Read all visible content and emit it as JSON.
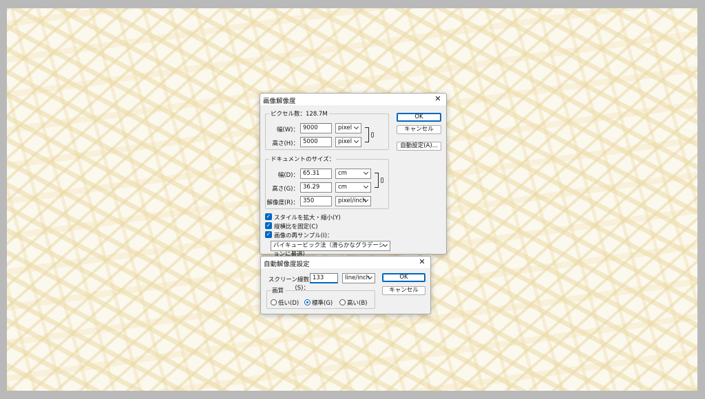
{
  "image_size": {
    "title": "画像解像度",
    "pixel_dimensions_label": "ピクセル数：128.7M",
    "width_label": "幅(W)：",
    "width_value": "9000",
    "width_unit": "pixel",
    "height_label": "高さ(H)：",
    "height_value": "5000",
    "height_unit": "pixel",
    "document_size_label": "ドキュメントのサイズ：",
    "doc_width_label": "幅(D)：",
    "doc_width_value": "65.31",
    "doc_width_unit": "cm",
    "doc_height_label": "高さ(G)：",
    "doc_height_value": "36.29",
    "doc_height_unit": "cm",
    "resolution_label": "解像度(R)：",
    "resolution_value": "350",
    "resolution_unit": "pixel/inch",
    "scale_styles_label": "スタイルを拡大・縮小(Y)",
    "constrain_label": "縦横比を固定(C)",
    "resample_label": "画像の再サンプル(I)：",
    "resample_method": "バイキュービック法（滑らかなグラデーションに最適）",
    "ok_label": "OK",
    "cancel_label": "キャンセル",
    "auto_label": "自動設定(A)..."
  },
  "auto_resolution": {
    "title": "自動解像度設定",
    "screen_label": "スクリーン線数(S)：",
    "screen_value": "133",
    "screen_unit": "line/inch",
    "quality_label": "画質",
    "quality_options": [
      "低い(D)",
      "標準(G)",
      "高い(B)"
    ],
    "quality_selected": "標準(G)",
    "ok_label": "OK",
    "cancel_label": "キャンセル"
  },
  "close_icon": "close-icon"
}
